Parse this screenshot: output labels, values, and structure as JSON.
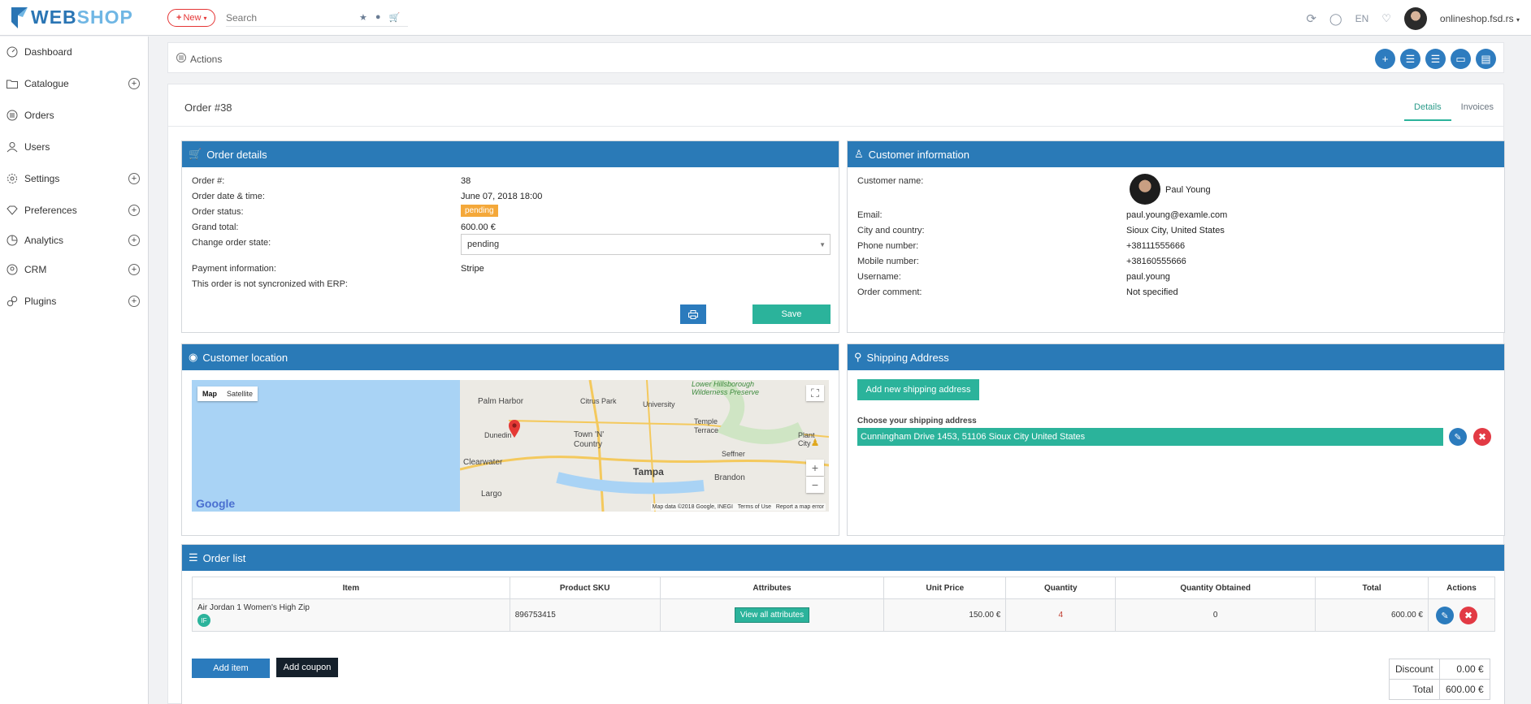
{
  "brand": {
    "name_part1": "WEB",
    "name_part2": "SHOP"
  },
  "topbar": {
    "new_label": "New",
    "search_placeholder": "Search",
    "language": "EN",
    "user": "onlineshop.fsd.rs"
  },
  "sidebar": {
    "items": [
      {
        "label": "Dashboard",
        "icon": "dashboard-icon",
        "expandable": false
      },
      {
        "label": "Catalogue",
        "icon": "folder-icon",
        "expandable": true
      },
      {
        "label": "Orders",
        "icon": "list-icon",
        "expandable": false
      },
      {
        "label": "Users",
        "icon": "user-icon",
        "expandable": false
      },
      {
        "label": "Settings",
        "icon": "gear-icon",
        "expandable": true
      },
      {
        "label": "Preferences",
        "icon": "diamond-icon",
        "expandable": true
      },
      {
        "label": "Analytics",
        "icon": "pie-chart-icon",
        "expandable": true
      },
      {
        "label": "CRM",
        "icon": "crm-icon",
        "expandable": true
      },
      {
        "label": "Plugins",
        "icon": "plugin-icon",
        "expandable": true
      }
    ]
  },
  "actions": {
    "label": "Actions"
  },
  "page": {
    "title": "Order #38",
    "tabs": [
      {
        "label": "Details",
        "active": true
      },
      {
        "label": "Invoices",
        "active": false
      }
    ]
  },
  "order_details": {
    "heading": "Order details",
    "labels": {
      "order_no": "Order #:",
      "datetime": "Order date & time:",
      "status": "Order status:",
      "grand_total": "Grand total:",
      "change_state": "Change order state:",
      "payment": "Payment information:",
      "erp": "This order is not syncronized with ERP:"
    },
    "values": {
      "order_no": "38",
      "datetime": "June 07, 2018 18:00",
      "status": "pending",
      "grand_total": "600.00 €",
      "change_state": "pending",
      "payment": "Stripe"
    },
    "save_label": "Save"
  },
  "customer_info": {
    "heading": "Customer information",
    "labels": {
      "name": "Customer name:",
      "email": "Email:",
      "city_country": "City and country:",
      "phone": "Phone number:",
      "mobile": "Mobile number:",
      "username": "Username:",
      "comment": "Order comment:"
    },
    "values": {
      "name": "Paul Young",
      "email": "paul.young@examle.com",
      "city_country": "Sioux City, United States",
      "phone": "+38111555666",
      "mobile": "+38160555666",
      "username": "paul.young",
      "comment": "Not specified"
    }
  },
  "customer_location": {
    "heading": "Customer location",
    "map_tab": "Map",
    "satellite_tab": "Satellite",
    "places": [
      "Palm Harbor",
      "Citrus Park",
      "University",
      "Lower Hillsborough Wilderness Preserve",
      "Temple Terrace",
      "Dunedin",
      "Town 'N' Country",
      "Plant City",
      "Clearwater",
      "Tampa",
      "Seffner",
      "Brandon",
      "Largo"
    ],
    "google": "Google",
    "footer": {
      "data": "Map data ©2018 Google, INEGI",
      "terms": "Terms of Use",
      "report": "Report a map error"
    }
  },
  "shipping": {
    "heading": "Shipping Address",
    "add_label": "Add new shipping address",
    "choose_label": "Choose your shipping address",
    "address": "Cunningham Drive 1453, 51106 Sioux City United States"
  },
  "order_list": {
    "heading": "Order list",
    "columns": [
      "Item",
      "Product SKU",
      "Attributes",
      "Unit Price",
      "Quantity",
      "Quantity Obtained",
      "Total",
      "Actions"
    ],
    "rows": [
      {
        "item": "Air Jordan 1 Women's High Zip",
        "badge": "IF",
        "sku": "896753415",
        "attributes_button": "View all attributes",
        "unit_price": "150.00 €",
        "quantity": "4",
        "quantity_obtained": "0",
        "total": "600.00 €"
      }
    ],
    "add_item_label": "Add item",
    "add_coupon_label": "Add coupon",
    "totals": [
      {
        "label": "Discount",
        "value": "0.00 €"
      },
      {
        "label": "Total",
        "value": "600.00 €"
      }
    ]
  },
  "colors": {
    "primary": "#2a7ab7",
    "accent_green": "#2bb39b",
    "danger": "#e23a44",
    "pending": "#f4a83a"
  }
}
